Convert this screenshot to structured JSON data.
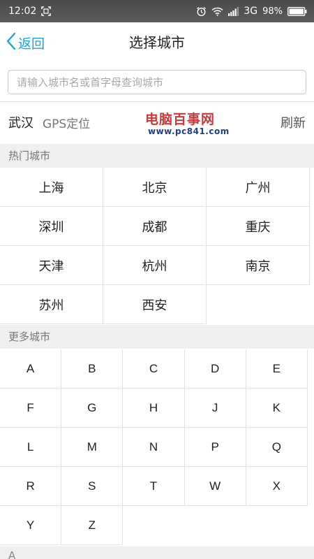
{
  "status_bar": {
    "time": "12:02",
    "network": "3G",
    "battery": "98%"
  },
  "nav": {
    "back_label": "返回",
    "title": "选择城市"
  },
  "search": {
    "placeholder": "请输入城市名或首字母查询城市",
    "value": ""
  },
  "gps": {
    "city": "武汉",
    "label": "GPS定位",
    "refresh_label": "刷新"
  },
  "watermark": {
    "name": "电脑百事网",
    "url": "www.pc841.com"
  },
  "hot_cities": {
    "header": "热门城市",
    "items": [
      "上海",
      "北京",
      "广州",
      "深圳",
      "成都",
      "重庆",
      "天津",
      "杭州",
      "南京",
      "苏州",
      "西安"
    ]
  },
  "more_cities": {
    "header": "更多城市",
    "letters": [
      "A",
      "B",
      "C",
      "D",
      "E",
      "F",
      "G",
      "H",
      "J",
      "K",
      "L",
      "M",
      "N",
      "P",
      "Q",
      "R",
      "S",
      "T",
      "W",
      "X",
      "Y",
      "Z"
    ]
  },
  "list_section": {
    "header": "A"
  },
  "colors": {
    "accent": "#1ba0e1",
    "watermark_red": "#c53a3a",
    "watermark_blue": "#1f3f8e"
  }
}
